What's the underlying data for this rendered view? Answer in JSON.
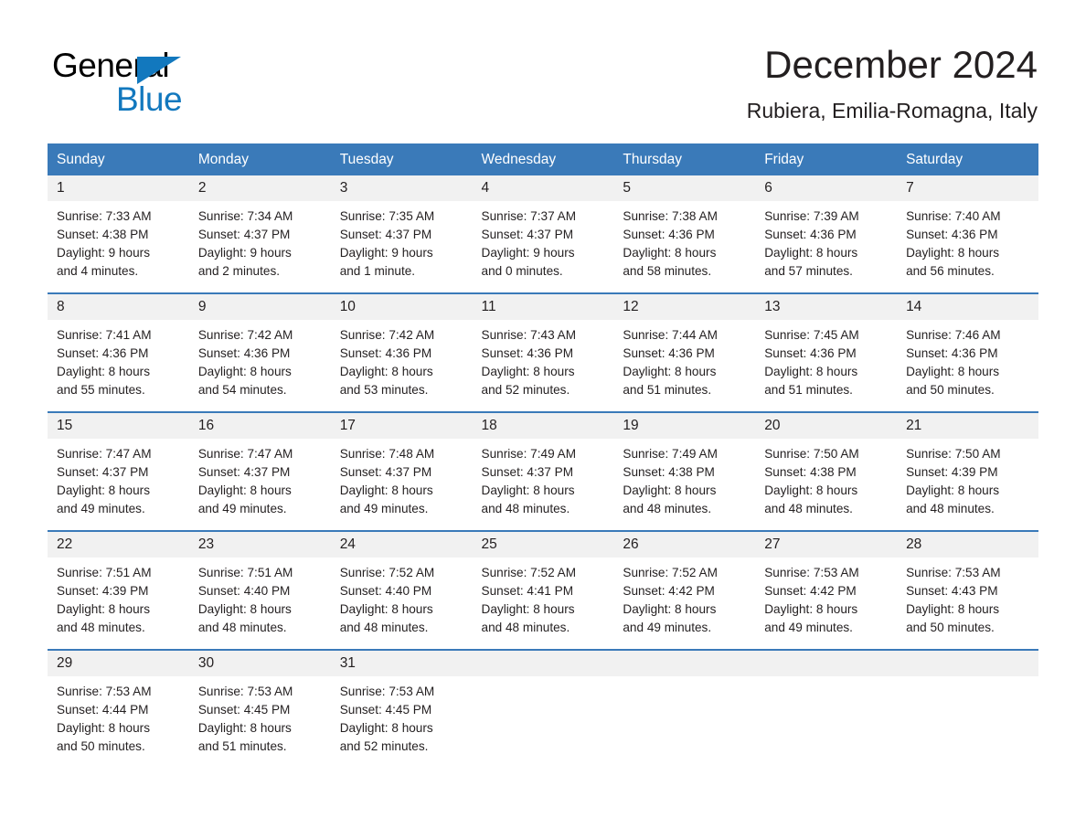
{
  "logo": {
    "word_one": "General",
    "word_two": "Blue",
    "triangle_icon": "triangle-icon",
    "brand_blue": "#1278be"
  },
  "header": {
    "title": "December 2024",
    "location": "Rubiera, Emilia-Romagna, Italy"
  },
  "theme": {
    "header_blue": "#3a7ab9",
    "daynum_background": "#f1f1f1",
    "text_color": "#231f20"
  },
  "calendar": {
    "weekdays": [
      "Sunday",
      "Monday",
      "Tuesday",
      "Wednesday",
      "Thursday",
      "Friday",
      "Saturday"
    ],
    "weeks": [
      [
        {
          "day": "1",
          "sunrise": "Sunrise: 7:33 AM",
          "sunset": "Sunset: 4:38 PM",
          "daylight1": "Daylight: 9 hours",
          "daylight2": "and 4 minutes."
        },
        {
          "day": "2",
          "sunrise": "Sunrise: 7:34 AM",
          "sunset": "Sunset: 4:37 PM",
          "daylight1": "Daylight: 9 hours",
          "daylight2": "and 2 minutes."
        },
        {
          "day": "3",
          "sunrise": "Sunrise: 7:35 AM",
          "sunset": "Sunset: 4:37 PM",
          "daylight1": "Daylight: 9 hours",
          "daylight2": "and 1 minute."
        },
        {
          "day": "4",
          "sunrise": "Sunrise: 7:37 AM",
          "sunset": "Sunset: 4:37 PM",
          "daylight1": "Daylight: 9 hours",
          "daylight2": "and 0 minutes."
        },
        {
          "day": "5",
          "sunrise": "Sunrise: 7:38 AM",
          "sunset": "Sunset: 4:36 PM",
          "daylight1": "Daylight: 8 hours",
          "daylight2": "and 58 minutes."
        },
        {
          "day": "6",
          "sunrise": "Sunrise: 7:39 AM",
          "sunset": "Sunset: 4:36 PM",
          "daylight1": "Daylight: 8 hours",
          "daylight2": "and 57 minutes."
        },
        {
          "day": "7",
          "sunrise": "Sunrise: 7:40 AM",
          "sunset": "Sunset: 4:36 PM",
          "daylight1": "Daylight: 8 hours",
          "daylight2": "and 56 minutes."
        }
      ],
      [
        {
          "day": "8",
          "sunrise": "Sunrise: 7:41 AM",
          "sunset": "Sunset: 4:36 PM",
          "daylight1": "Daylight: 8 hours",
          "daylight2": "and 55 minutes."
        },
        {
          "day": "9",
          "sunrise": "Sunrise: 7:42 AM",
          "sunset": "Sunset: 4:36 PM",
          "daylight1": "Daylight: 8 hours",
          "daylight2": "and 54 minutes."
        },
        {
          "day": "10",
          "sunrise": "Sunrise: 7:42 AM",
          "sunset": "Sunset: 4:36 PM",
          "daylight1": "Daylight: 8 hours",
          "daylight2": "and 53 minutes."
        },
        {
          "day": "11",
          "sunrise": "Sunrise: 7:43 AM",
          "sunset": "Sunset: 4:36 PM",
          "daylight1": "Daylight: 8 hours",
          "daylight2": "and 52 minutes."
        },
        {
          "day": "12",
          "sunrise": "Sunrise: 7:44 AM",
          "sunset": "Sunset: 4:36 PM",
          "daylight1": "Daylight: 8 hours",
          "daylight2": "and 51 minutes."
        },
        {
          "day": "13",
          "sunrise": "Sunrise: 7:45 AM",
          "sunset": "Sunset: 4:36 PM",
          "daylight1": "Daylight: 8 hours",
          "daylight2": "and 51 minutes."
        },
        {
          "day": "14",
          "sunrise": "Sunrise: 7:46 AM",
          "sunset": "Sunset: 4:36 PM",
          "daylight1": "Daylight: 8 hours",
          "daylight2": "and 50 minutes."
        }
      ],
      [
        {
          "day": "15",
          "sunrise": "Sunrise: 7:47 AM",
          "sunset": "Sunset: 4:37 PM",
          "daylight1": "Daylight: 8 hours",
          "daylight2": "and 49 minutes."
        },
        {
          "day": "16",
          "sunrise": "Sunrise: 7:47 AM",
          "sunset": "Sunset: 4:37 PM",
          "daylight1": "Daylight: 8 hours",
          "daylight2": "and 49 minutes."
        },
        {
          "day": "17",
          "sunrise": "Sunrise: 7:48 AM",
          "sunset": "Sunset: 4:37 PM",
          "daylight1": "Daylight: 8 hours",
          "daylight2": "and 49 minutes."
        },
        {
          "day": "18",
          "sunrise": "Sunrise: 7:49 AM",
          "sunset": "Sunset: 4:37 PM",
          "daylight1": "Daylight: 8 hours",
          "daylight2": "and 48 minutes."
        },
        {
          "day": "19",
          "sunrise": "Sunrise: 7:49 AM",
          "sunset": "Sunset: 4:38 PM",
          "daylight1": "Daylight: 8 hours",
          "daylight2": "and 48 minutes."
        },
        {
          "day": "20",
          "sunrise": "Sunrise: 7:50 AM",
          "sunset": "Sunset: 4:38 PM",
          "daylight1": "Daylight: 8 hours",
          "daylight2": "and 48 minutes."
        },
        {
          "day": "21",
          "sunrise": "Sunrise: 7:50 AM",
          "sunset": "Sunset: 4:39 PM",
          "daylight1": "Daylight: 8 hours",
          "daylight2": "and 48 minutes."
        }
      ],
      [
        {
          "day": "22",
          "sunrise": "Sunrise: 7:51 AM",
          "sunset": "Sunset: 4:39 PM",
          "daylight1": "Daylight: 8 hours",
          "daylight2": "and 48 minutes."
        },
        {
          "day": "23",
          "sunrise": "Sunrise: 7:51 AM",
          "sunset": "Sunset: 4:40 PM",
          "daylight1": "Daylight: 8 hours",
          "daylight2": "and 48 minutes."
        },
        {
          "day": "24",
          "sunrise": "Sunrise: 7:52 AM",
          "sunset": "Sunset: 4:40 PM",
          "daylight1": "Daylight: 8 hours",
          "daylight2": "and 48 minutes."
        },
        {
          "day": "25",
          "sunrise": "Sunrise: 7:52 AM",
          "sunset": "Sunset: 4:41 PM",
          "daylight1": "Daylight: 8 hours",
          "daylight2": "and 48 minutes."
        },
        {
          "day": "26",
          "sunrise": "Sunrise: 7:52 AM",
          "sunset": "Sunset: 4:42 PM",
          "daylight1": "Daylight: 8 hours",
          "daylight2": "and 49 minutes."
        },
        {
          "day": "27",
          "sunrise": "Sunrise: 7:53 AM",
          "sunset": "Sunset: 4:42 PM",
          "daylight1": "Daylight: 8 hours",
          "daylight2": "and 49 minutes."
        },
        {
          "day": "28",
          "sunrise": "Sunrise: 7:53 AM",
          "sunset": "Sunset: 4:43 PM",
          "daylight1": "Daylight: 8 hours",
          "daylight2": "and 50 minutes."
        }
      ],
      [
        {
          "day": "29",
          "sunrise": "Sunrise: 7:53 AM",
          "sunset": "Sunset: 4:44 PM",
          "daylight1": "Daylight: 8 hours",
          "daylight2": "and 50 minutes."
        },
        {
          "day": "30",
          "sunrise": "Sunrise: 7:53 AM",
          "sunset": "Sunset: 4:45 PM",
          "daylight1": "Daylight: 8 hours",
          "daylight2": "and 51 minutes."
        },
        {
          "day": "31",
          "sunrise": "Sunrise: 7:53 AM",
          "sunset": "Sunset: 4:45 PM",
          "daylight1": "Daylight: 8 hours",
          "daylight2": "and 52 minutes."
        },
        {
          "day": "",
          "sunrise": "",
          "sunset": "",
          "daylight1": "",
          "daylight2": ""
        },
        {
          "day": "",
          "sunrise": "",
          "sunset": "",
          "daylight1": "",
          "daylight2": ""
        },
        {
          "day": "",
          "sunrise": "",
          "sunset": "",
          "daylight1": "",
          "daylight2": ""
        },
        {
          "day": "",
          "sunrise": "",
          "sunset": "",
          "daylight1": "",
          "daylight2": ""
        }
      ]
    ]
  }
}
